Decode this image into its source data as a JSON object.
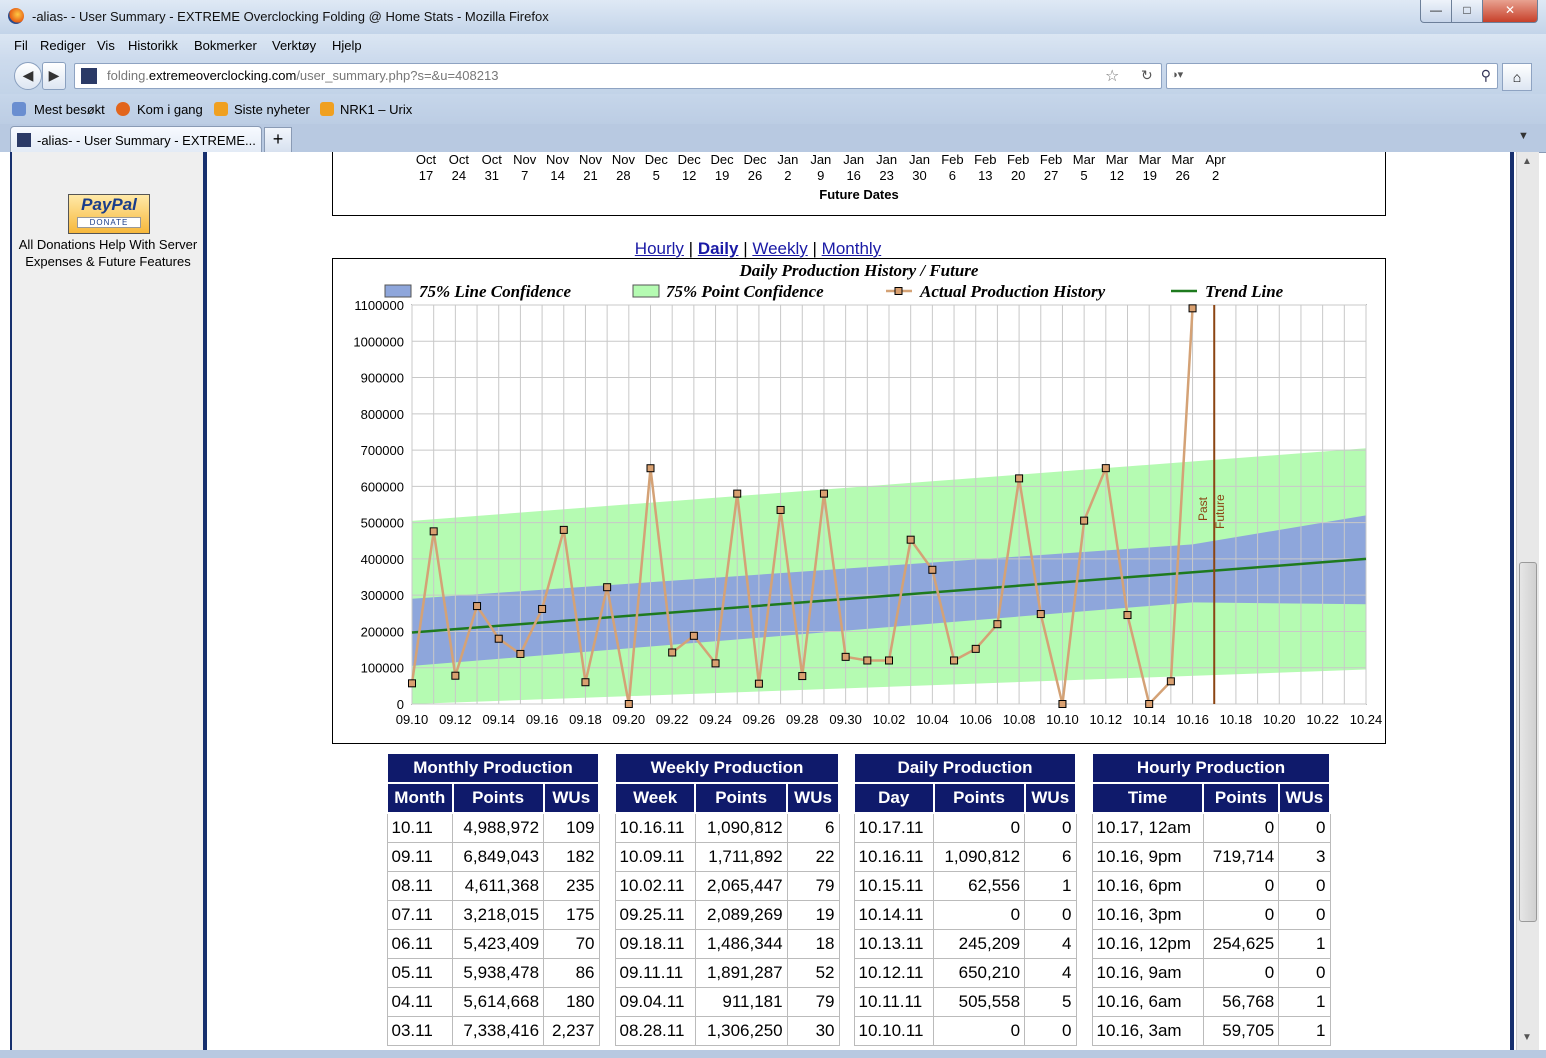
{
  "window": {
    "title": "-alias- - User Summary - EXTREME Overclocking Folding @ Home Stats - Mozilla Firefox"
  },
  "menu": [
    "Fil",
    "Rediger",
    "Vis",
    "Historikk",
    "Bokmerker",
    "Verktøy",
    "Hjelp"
  ],
  "url": {
    "domain": "folding.",
    "host": "extremeoverclocking.com",
    "path": "/user_summary.php?s=&u=408213"
  },
  "bookmarks": [
    "Mest besøkt",
    "Kom i gang",
    "Siste nyheter",
    "NRK1 – Urix"
  ],
  "tab": {
    "title": "-alias- - User Summary - EXTREME..."
  },
  "sidebar": {
    "paypal_brand": "PayPal",
    "paypal_action": "DONATE",
    "donation_text": "All Donations Help With Server Expenses & Future Features"
  },
  "future_chart": {
    "dates": [
      [
        "Oct",
        "17"
      ],
      [
        "Oct",
        "24"
      ],
      [
        "Oct",
        "31"
      ],
      [
        "Nov",
        "7"
      ],
      [
        "Nov",
        "14"
      ],
      [
        "Nov",
        "21"
      ],
      [
        "Nov",
        "28"
      ],
      [
        "Dec",
        "5"
      ],
      [
        "Dec",
        "12"
      ],
      [
        "Dec",
        "19"
      ],
      [
        "Dec",
        "26"
      ],
      [
        "Jan",
        "2"
      ],
      [
        "Jan",
        "9"
      ],
      [
        "Jan",
        "16"
      ],
      [
        "Jan",
        "23"
      ],
      [
        "Jan",
        "30"
      ],
      [
        "Feb",
        "6"
      ],
      [
        "Feb",
        "13"
      ],
      [
        "Feb",
        "20"
      ],
      [
        "Feb",
        "27"
      ],
      [
        "Mar",
        "5"
      ],
      [
        "Mar",
        "12"
      ],
      [
        "Mar",
        "19"
      ],
      [
        "Mar",
        "26"
      ],
      [
        "Apr",
        "2"
      ]
    ],
    "xlabel": "Future Dates"
  },
  "range_links": {
    "hourly": "Hourly",
    "daily": "Daily",
    "weekly": "Weekly",
    "monthly": "Monthly",
    "separator": "|"
  },
  "chart_data": {
    "type": "line",
    "title": "Daily Production History / Future",
    "legend": [
      "75% Line Confidence",
      "75% Point Confidence",
      "Actual Production History",
      "Trend Line"
    ],
    "legend_placement": "top",
    "xlabel": "",
    "ylabel": "",
    "x_ticks": [
      "09.10",
      "09.12",
      "09.14",
      "09.16",
      "09.18",
      "09.20",
      "09.22",
      "09.24",
      "09.26",
      "09.28",
      "09.30",
      "10.02",
      "10.04",
      "10.06",
      "10.08",
      "10.10",
      "10.12",
      "10.14",
      "10.16",
      "10.18",
      "10.20",
      "10.22",
      "10.24"
    ],
    "x_range": [
      "09.10",
      "10.24"
    ],
    "ylim": [
      0,
      1100000
    ],
    "y_ticks": [
      0,
      100000,
      200000,
      300000,
      400000,
      500000,
      600000,
      700000,
      800000,
      900000,
      1000000,
      1100000
    ],
    "grid": true,
    "series": [
      {
        "name": "Actual Production History",
        "x": [
          "09.10",
          "09.11",
          "09.12",
          "09.13",
          "09.14",
          "09.15",
          "09.16",
          "09.17",
          "09.18",
          "09.19",
          "09.20",
          "09.21",
          "09.22",
          "09.23",
          "09.24",
          "09.25",
          "09.26",
          "09.27",
          "09.28",
          "09.29",
          "09.30",
          "10.01",
          "10.02",
          "10.03",
          "10.04",
          "10.05",
          "10.06",
          "10.07",
          "10.08",
          "10.09",
          "10.10",
          "10.11",
          "10.12",
          "10.13",
          "10.14",
          "10.15",
          "10.16"
        ],
        "values": [
          57000,
          476000,
          78000,
          270000,
          180000,
          138000,
          262000,
          480000,
          60000,
          322000,
          0,
          650000,
          142000,
          188000,
          112000,
          580000,
          56000,
          535000,
          77000,
          580000,
          130000,
          120000,
          120000,
          453000,
          370000,
          120000,
          152000,
          220000,
          622000,
          248000,
          0,
          505558,
          650210,
          245209,
          0,
          62556,
          1090812
        ]
      },
      {
        "name": "Trend Line",
        "x": [
          "09.10",
          "10.24"
        ],
        "values": [
          197000,
          400000
        ]
      },
      {
        "name": "75% Line Confidence",
        "x": [
          "09.10",
          "10.16",
          "10.24"
        ],
        "upper": [
          290000,
          440000,
          520000
        ],
        "lower": [
          105000,
          280000,
          275000
        ]
      },
      {
        "name": "75% Point Confidence",
        "x": [
          "09.10",
          "10.24"
        ],
        "upper": [
          505000,
          705000
        ],
        "lower": [
          0,
          95000
        ]
      }
    ],
    "markers": {
      "divider_x": "10.17",
      "past_label": "Past",
      "future_label": "Future"
    },
    "colors": {
      "line_conf": "#8ea6db",
      "point_conf": "#b5fbb2",
      "actual": "#d4a276",
      "trend": "#1e7a1e",
      "divider": "#8b4513"
    }
  },
  "tables": {
    "monthly": {
      "title": "Monthly Production",
      "headers": [
        "Month",
        "Points",
        "WUs"
      ],
      "rows": [
        [
          "10.11",
          "4,988,972",
          "109"
        ],
        [
          "09.11",
          "6,849,043",
          "182"
        ],
        [
          "08.11",
          "4,611,368",
          "235"
        ],
        [
          "07.11",
          "3,218,015",
          "175"
        ],
        [
          "06.11",
          "5,423,409",
          "70"
        ],
        [
          "05.11",
          "5,938,478",
          "86"
        ],
        [
          "04.11",
          "5,614,668",
          "180"
        ],
        [
          "03.11",
          "7,338,416",
          "2,237"
        ]
      ]
    },
    "weekly": {
      "title": "Weekly Production",
      "headers": [
        "Week",
        "Points",
        "WUs"
      ],
      "rows": [
        [
          "10.16.11",
          "1,090,812",
          "6"
        ],
        [
          "10.09.11",
          "1,711,892",
          "22"
        ],
        [
          "10.02.11",
          "2,065,447",
          "79"
        ],
        [
          "09.25.11",
          "2,089,269",
          "19"
        ],
        [
          "09.18.11",
          "1,486,344",
          "18"
        ],
        [
          "09.11.11",
          "1,891,287",
          "52"
        ],
        [
          "09.04.11",
          "911,181",
          "79"
        ],
        [
          "08.28.11",
          "1,306,250",
          "30"
        ]
      ]
    },
    "daily": {
      "title": "Daily Production",
      "headers": [
        "Day",
        "Points",
        "WUs"
      ],
      "rows": [
        [
          "10.17.11",
          "0",
          "0"
        ],
        [
          "10.16.11",
          "1,090,812",
          "6"
        ],
        [
          "10.15.11",
          "62,556",
          "1"
        ],
        [
          "10.14.11",
          "0",
          "0"
        ],
        [
          "10.13.11",
          "245,209",
          "4"
        ],
        [
          "10.12.11",
          "650,210",
          "4"
        ],
        [
          "10.11.11",
          "505,558",
          "5"
        ],
        [
          "10.10.11",
          "0",
          "0"
        ]
      ]
    },
    "hourly": {
      "title": "Hourly Production",
      "headers": [
        "Time",
        "Points",
        "WUs"
      ],
      "rows": [
        [
          "10.17, 12am",
          "0",
          "0"
        ],
        [
          "10.16, 9pm",
          "719,714",
          "3"
        ],
        [
          "10.16, 6pm",
          "0",
          "0"
        ],
        [
          "10.16, 3pm",
          "0",
          "0"
        ],
        [
          "10.16, 12pm",
          "254,625",
          "1"
        ],
        [
          "10.16, 9am",
          "0",
          "0"
        ],
        [
          "10.16, 6am",
          "56,768",
          "1"
        ],
        [
          "10.16, 3am",
          "59,705",
          "1"
        ]
      ]
    }
  }
}
